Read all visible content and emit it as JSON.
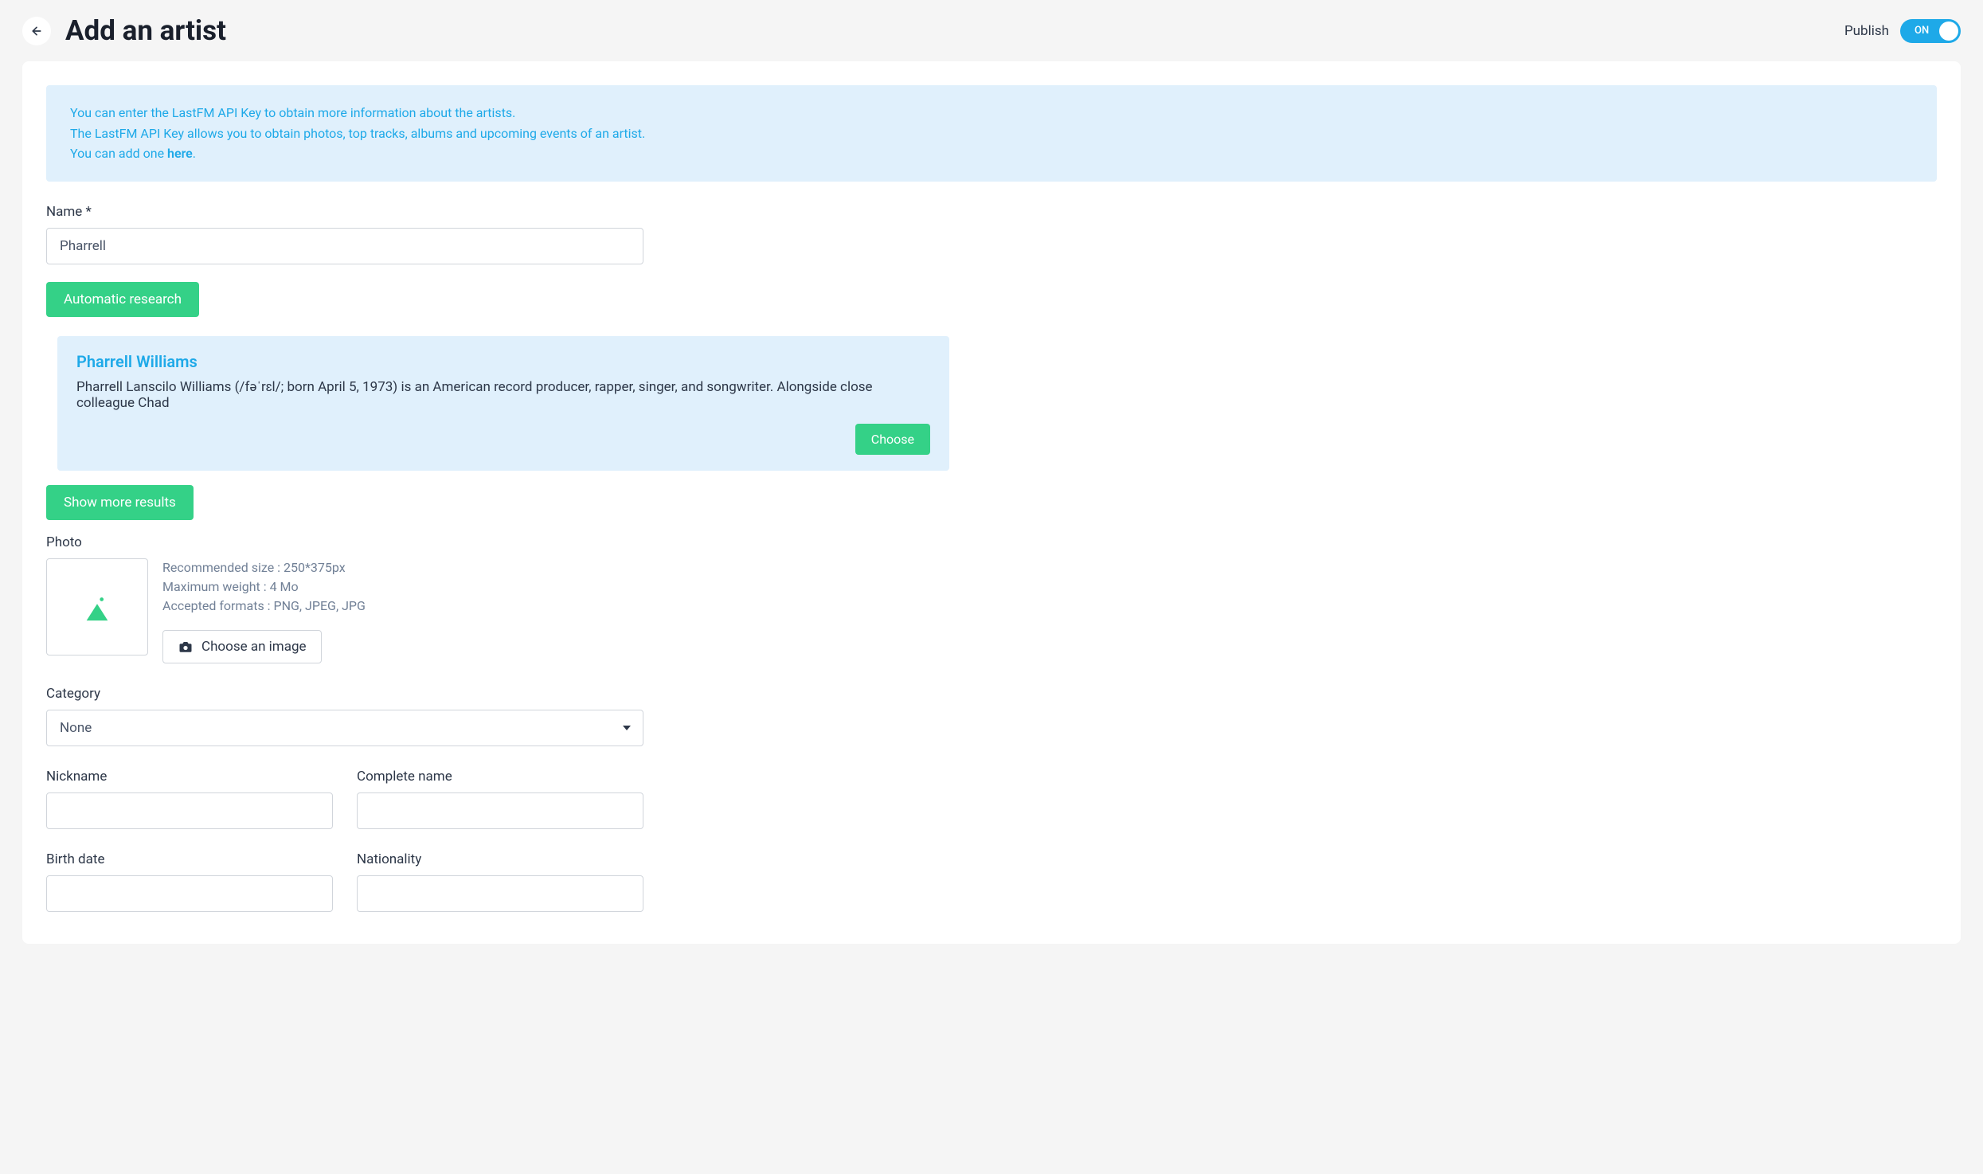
{
  "header": {
    "title": "Add an artist",
    "publish_label": "Publish",
    "toggle_label": "ON"
  },
  "banner": {
    "line1": "You can enter the LastFM API Key to obtain more information about the artists.",
    "line2": "The LastFM API Key allows you to obtain photos, top tracks, albums and upcoming events of an artist.",
    "line3_prefix": "You can add one ",
    "line3_link": "here",
    "line3_suffix": "."
  },
  "form": {
    "name_label": "Name *",
    "name_value": "Pharrell",
    "research_button": "Automatic research",
    "show_more_button": "Show more results",
    "photo_label": "Photo",
    "photo_size": "Recommended size : 250*375px",
    "photo_weight": "Maximum weight : 4 Mo",
    "photo_formats": "Accepted formats : PNG, JPEG, JPG",
    "choose_image_button": "Choose an image",
    "category_label": "Category",
    "category_value": "None",
    "nickname_label": "Nickname",
    "nickname_value": "",
    "complete_name_label": "Complete name",
    "complete_name_value": "",
    "birth_date_label": "Birth date",
    "birth_date_value": "",
    "nationality_label": "Nationality",
    "nationality_value": ""
  },
  "result": {
    "title": "Pharrell Williams",
    "description": "Pharrell Lanscilo Williams (/fəˈrɛl/; born April 5, 1973) is an American record producer, rapper, singer, and songwriter. Alongside close colleague Chad",
    "choose_button": "Choose"
  }
}
